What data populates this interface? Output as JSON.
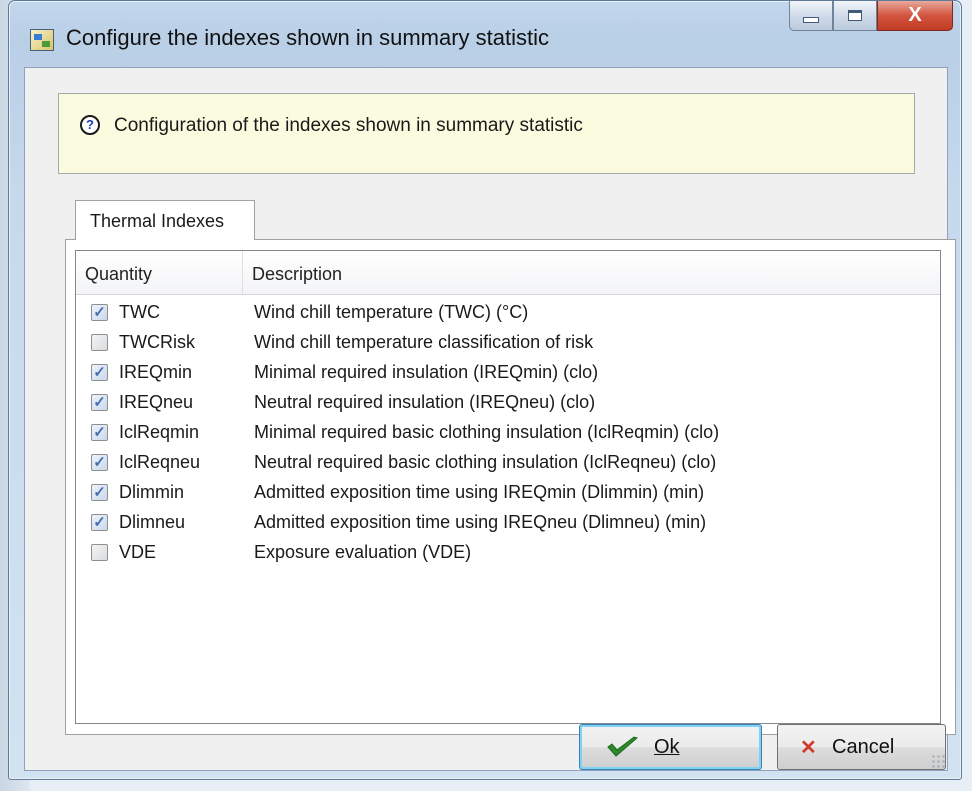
{
  "window": {
    "title": "Configure the indexes shown in summary statistic",
    "close_glyph": "X"
  },
  "info": {
    "text": "Configuration of the indexes shown in summary statistic",
    "icon": "question-icon"
  },
  "tabs": [
    {
      "label": "Thermal Indexes",
      "selected": true
    }
  ],
  "list": {
    "headers": {
      "quantity": "Quantity",
      "description": "Description"
    },
    "rows": [
      {
        "checked": true,
        "quantity": "TWC",
        "description": "Wind chill temperature (TWC) (°C)"
      },
      {
        "checked": false,
        "quantity": "TWCRisk",
        "description": "Wind chill temperature classification of risk"
      },
      {
        "checked": true,
        "quantity": "IREQmin",
        "description": "Minimal required insulation  (IREQmin) (clo)"
      },
      {
        "checked": true,
        "quantity": "IREQneu",
        "description": "Neutral required insulation (IREQneu) (clo)"
      },
      {
        "checked": true,
        "quantity": "IclReqmin",
        "description": "Minimal required basic clothing insulation (IclReqmin) (clo)"
      },
      {
        "checked": true,
        "quantity": "IclReqneu",
        "description": "Neutral required basic clothing insulation (IclReqneu) (clo)"
      },
      {
        "checked": true,
        "quantity": "Dlimmin",
        "description": "Admitted exposition time using IREQmin (Dlimmin) (min)"
      },
      {
        "checked": true,
        "quantity": "Dlimneu",
        "description": "Admitted exposition time using IREQneu (Dlimneu)  (min)"
      },
      {
        "checked": false,
        "quantity": "VDE",
        "description": "Exposure evaluation (VDE)"
      }
    ]
  },
  "buttons": {
    "ok": "Ok",
    "cancel": "Cancel"
  },
  "colors": {
    "ok_check": "#2a8a2a",
    "cancel_x": "#d23a2b",
    "info_bg": "#fbfbe0"
  }
}
